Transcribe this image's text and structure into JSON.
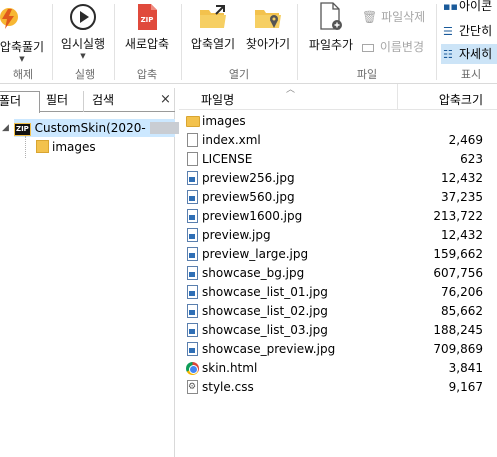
{
  "ribbon": {
    "groups": [
      {
        "label": "해제"
      },
      {
        "label": "실행"
      },
      {
        "label": "압축"
      },
      {
        "label": "열기"
      },
      {
        "label": "파일"
      },
      {
        "label": "표시"
      }
    ],
    "extract_label": "압축풀기",
    "temp_run_label": "임시실행",
    "new_archive_label": "새로압축",
    "open_archive_label": "압축열기",
    "find_label": "찾아가기",
    "add_file_label": "파일추가",
    "delete_file_label": "파일삭제",
    "rename_label": "이름변경",
    "view_icons_label": "아이콘",
    "view_simple_label": "간단히",
    "view_details_label": "자세히"
  },
  "left_panel": {
    "tabs": [
      "폴더",
      "필터",
      "검색"
    ],
    "close_glyph": "×",
    "tree": {
      "root_label": "CustomSkin(2020-",
      "root_badge": "ZIP",
      "child_label": "images"
    }
  },
  "file_list": {
    "columns": {
      "name": "파일명",
      "size": "압축크기"
    },
    "rows": [
      {
        "icon": "folder-icon",
        "name": "images",
        "size": ""
      },
      {
        "icon": "document-icon",
        "name": "index.xml",
        "size": "2,469"
      },
      {
        "icon": "document-icon",
        "name": "LICENSE",
        "size": "623"
      },
      {
        "icon": "image-file-icon",
        "name": "preview256.jpg",
        "size": "12,432"
      },
      {
        "icon": "image-file-icon",
        "name": "preview560.jpg",
        "size": "37,235"
      },
      {
        "icon": "image-file-icon",
        "name": "preview1600.jpg",
        "size": "213,722"
      },
      {
        "icon": "image-file-icon",
        "name": "preview.jpg",
        "size": "12,432"
      },
      {
        "icon": "image-file-icon",
        "name": "preview_large.jpg",
        "size": "159,662"
      },
      {
        "icon": "image-file-icon",
        "name": "showcase_bg.jpg",
        "size": "607,756"
      },
      {
        "icon": "image-file-icon",
        "name": "showcase_list_01.jpg",
        "size": "76,206"
      },
      {
        "icon": "image-file-icon",
        "name": "showcase_list_02.jpg",
        "size": "85,662"
      },
      {
        "icon": "image-file-icon",
        "name": "showcase_list_03.jpg",
        "size": "188,245"
      },
      {
        "icon": "image-file-icon",
        "name": "showcase_preview.jpg",
        "size": "709,869"
      },
      {
        "icon": "chrome-icon",
        "name": "skin.html",
        "size": "3,841"
      },
      {
        "icon": "css-file-icon",
        "name": "style.css",
        "size": "9,167"
      }
    ]
  },
  "colors": {
    "selection": "#cce8ff",
    "view_active": "#cce4f7",
    "folder": "#f3c24d",
    "accent": "#2f6fb6",
    "zip_red": "#e04a3c"
  }
}
